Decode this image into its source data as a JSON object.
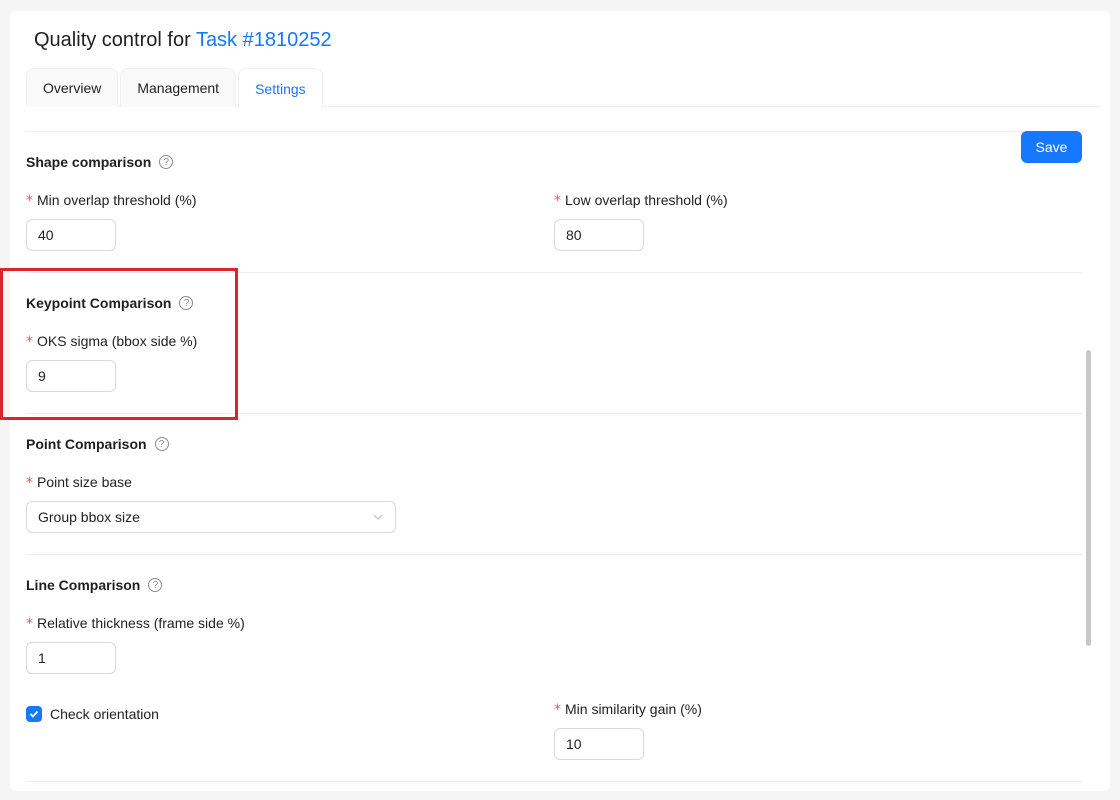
{
  "header": {
    "title_prefix": "Quality control for",
    "task_link": "Task #1810252"
  },
  "tabs": [
    {
      "label": "Overview",
      "active": false
    },
    {
      "label": "Management",
      "active": false
    },
    {
      "label": "Settings",
      "active": true
    }
  ],
  "toolbar": {
    "save_label": "Save"
  },
  "shape_comparison": {
    "title": "Shape comparison",
    "min_overlap": {
      "label": "Min overlap threshold (%)",
      "value": "40"
    },
    "low_overlap": {
      "label": "Low overlap threshold (%)",
      "value": "80"
    }
  },
  "keypoint_comparison": {
    "title": "Keypoint Comparison",
    "oks_sigma": {
      "label": "OKS sigma (bbox side %)",
      "value": "9"
    }
  },
  "point_comparison": {
    "title": "Point Comparison",
    "point_size_base": {
      "label": "Point size base",
      "value": "Group bbox size"
    }
  },
  "line_comparison": {
    "title": "Line Comparison",
    "relative_thickness": {
      "label": "Relative thickness (frame side %)",
      "value": "1"
    },
    "check_orientation": {
      "label": "Check orientation",
      "checked": true
    },
    "min_similarity_gain": {
      "label": "Min similarity gain (%)",
      "value": "10"
    }
  },
  "required_mark": "*",
  "help_glyph": "?",
  "colors": {
    "primary": "#1677ff",
    "required": "#ff4d4f",
    "highlight": "#d9262c"
  }
}
